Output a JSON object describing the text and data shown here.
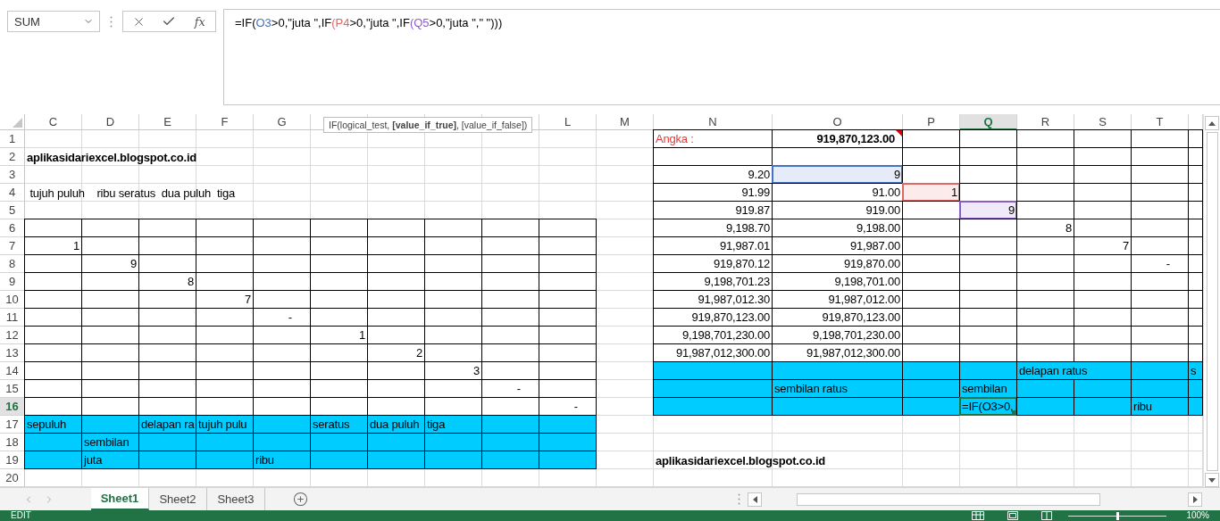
{
  "name_box": {
    "value": "SUM"
  },
  "function_button": "fx",
  "formula_bar": {
    "parts": [
      {
        "text": "=IF("
      },
      {
        "text": "O3",
        "color": "#4472c4"
      },
      {
        "text": ">0,\"juta \",IF"
      },
      {
        "text": "(P4",
        "color": "#e06666"
      },
      {
        "text": ">0,\"juta \",IF"
      },
      {
        "text": "(Q5",
        "color": "#8e5cc7"
      },
      {
        "text": ">0,\"juta \",\" \")))"
      }
    ]
  },
  "tooltip": "IF(logical_test, **[value_if_true]**, [value_if_false])",
  "columns": [
    {
      "label": "C",
      "selected": false
    },
    {
      "label": "D",
      "selected": false
    },
    {
      "label": "E",
      "selected": false
    },
    {
      "label": "F",
      "selected": false
    },
    {
      "label": "G",
      "selected": false
    },
    {
      "selected": false
    },
    {
      "selected": false
    },
    {
      "selected": false
    },
    {
      "selected": false
    },
    {
      "label": "L",
      "selected": false
    },
    {
      "label": "M",
      "selected": false
    },
    {
      "label": "N",
      "selected": false
    },
    {
      "label": "O",
      "selected": false
    },
    {
      "label": "P",
      "selected": false
    },
    {
      "label": "Q",
      "selected": true
    },
    {
      "label": "R",
      "selected": false
    },
    {
      "label": "S",
      "selected": false
    },
    {
      "label": "T",
      "selected": false
    },
    {
      "selected": false
    }
  ],
  "rows": [
    {
      "label": "1",
      "selected": false,
      "cells": [
        {
          "kind": "plain"
        },
        {
          "kind": "plain"
        },
        {
          "kind": "plain"
        },
        {
          "kind": "plain"
        },
        {
          "kind": "plain"
        },
        {
          "kind": "plain"
        },
        {
          "kind": "plain"
        },
        {
          "kind": "plain"
        },
        {
          "kind": "plain"
        },
        {
          "kind": "plain"
        },
        {
          "kind": "plain"
        },
        {
          "kind": "label",
          "text": "Angka :",
          "color": "#e03c3c"
        },
        {
          "kind": "total",
          "text": "919,870,123.00"
        },
        {
          "kind": "box"
        },
        {
          "kind": "box"
        },
        {
          "kind": "box"
        },
        {
          "kind": "box"
        },
        {
          "kind": "box"
        },
        {
          "kind": "box"
        }
      ]
    },
    {
      "label": "2",
      "selected": false,
      "cells": [
        {
          "kind": "heading",
          "text": "aplikasidariexcel.blogspot.co.id"
        },
        {
          "kind": "plain"
        },
        {
          "kind": "plain"
        },
        {
          "kind": "plain"
        },
        {
          "kind": "plain"
        },
        {
          "kind": "plain"
        },
        {
          "kind": "plain"
        },
        {
          "kind": "plain"
        },
        {
          "kind": "plain"
        },
        {
          "kind": "plain"
        },
        {
          "kind": "plain"
        },
        {
          "kind": "box"
        },
        {
          "kind": "box"
        },
        {
          "kind": "box"
        },
        {
          "kind": "box"
        },
        {
          "kind": "box"
        },
        {
          "kind": "box"
        },
        {
          "kind": "box"
        },
        {
          "kind": "box"
        }
      ]
    },
    {
      "label": "3",
      "selected": false,
      "cells": [
        {
          "kind": "plain"
        },
        {
          "kind": "plain"
        },
        {
          "kind": "plain"
        },
        {
          "kind": "plain"
        },
        {
          "kind": "plain"
        },
        {
          "kind": "plain"
        },
        {
          "kind": "plain"
        },
        {
          "kind": "plain"
        },
        {
          "kind": "plain"
        },
        {
          "kind": "plain"
        },
        {
          "kind": "plain"
        },
        {
          "kind": "number",
          "text": "9.20"
        },
        {
          "kind": "reference",
          "text": "9",
          "color": "#4472c4"
        },
        {
          "kind": "box"
        },
        {
          "kind": "box"
        },
        {
          "kind": "box"
        },
        {
          "kind": "box"
        },
        {
          "kind": "box"
        },
        {
          "kind": "box"
        }
      ]
    },
    {
      "label": "4",
      "selected": false,
      "cells": [
        {
          "kind": "plain",
          "text": " tujuh puluh    ribu seratus  dua puluh  tiga"
        },
        {
          "kind": "plain"
        },
        {
          "kind": "plain"
        },
        {
          "kind": "plain"
        },
        {
          "kind": "plain"
        },
        {
          "kind": "plain"
        },
        {
          "kind": "plain"
        },
        {
          "kind": "plain"
        },
        {
          "kind": "plain"
        },
        {
          "kind": "plain"
        },
        {
          "kind": "plain"
        },
        {
          "kind": "number",
          "text": "91.99"
        },
        {
          "kind": "number",
          "text": "91.00"
        },
        {
          "kind": "reference",
          "text": "1",
          "color": "#e06666"
        },
        {
          "kind": "box"
        },
        {
          "kind": "box"
        },
        {
          "kind": "box"
        },
        {
          "kind": "box"
        },
        {
          "kind": "box"
        }
      ]
    },
    {
      "label": "5",
      "selected": false,
      "cells": [
        {
          "kind": "plain"
        },
        {
          "kind": "plain"
        },
        {
          "kind": "plain"
        },
        {
          "kind": "plain"
        },
        {
          "kind": "plain"
        },
        {
          "kind": "plain"
        },
        {
          "kind": "plain"
        },
        {
          "kind": "plain"
        },
        {
          "kind": "plain"
        },
        {
          "kind": "plain"
        },
        {
          "kind": "plain"
        },
        {
          "kind": "number",
          "text": "919.87"
        },
        {
          "kind": "number",
          "text": "919.00"
        },
        {
          "kind": "box"
        },
        {
          "kind": "reference",
          "text": "9",
          "color": "#8e5cc7"
        },
        {
          "kind": "box"
        },
        {
          "kind": "box"
        },
        {
          "kind": "box"
        },
        {
          "kind": "box"
        }
      ]
    },
    {
      "label": "6",
      "selected": false,
      "cells": [
        {
          "kind": "box"
        },
        {
          "kind": "box"
        },
        {
          "kind": "box"
        },
        {
          "kind": "box"
        },
        {
          "kind": "box"
        },
        {
          "kind": "box"
        },
        {
          "kind": "box"
        },
        {
          "kind": "box"
        },
        {
          "kind": "box"
        },
        {
          "kind": "box"
        },
        {
          "kind": "plain"
        },
        {
          "kind": "number",
          "text": "9,198.70"
        },
        {
          "kind": "number",
          "text": "9,198.00"
        },
        {
          "kind": "box"
        },
        {
          "kind": "box"
        },
        {
          "kind": "number",
          "text": "8"
        },
        {
          "kind": "box"
        },
        {
          "kind": "box"
        },
        {
          "kind": "box"
        }
      ]
    },
    {
      "label": "7",
      "selected": false,
      "cells": [
        {
          "kind": "number",
          "text": "1"
        },
        {
          "kind": "box"
        },
        {
          "kind": "box"
        },
        {
          "kind": "box"
        },
        {
          "kind": "box"
        },
        {
          "kind": "box"
        },
        {
          "kind": "box"
        },
        {
          "kind": "box"
        },
        {
          "kind": "box"
        },
        {
          "kind": "box"
        },
        {
          "kind": "plain"
        },
        {
          "kind": "number",
          "text": "91,987.01"
        },
        {
          "kind": "number",
          "text": "91,987.00"
        },
        {
          "kind": "box"
        },
        {
          "kind": "box"
        },
        {
          "kind": "box"
        },
        {
          "kind": "number",
          "text": "7"
        },
        {
          "kind": "box"
        },
        {
          "kind": "box"
        }
      ]
    },
    {
      "label": "8",
      "selected": false,
      "cells": [
        {
          "kind": "box"
        },
        {
          "kind": "number",
          "text": "9"
        },
        {
          "kind": "box"
        },
        {
          "kind": "box"
        },
        {
          "kind": "box"
        },
        {
          "kind": "box"
        },
        {
          "kind": "box"
        },
        {
          "kind": "box"
        },
        {
          "kind": "box"
        },
        {
          "kind": "box"
        },
        {
          "kind": "plain"
        },
        {
          "kind": "number",
          "text": "919,870.12"
        },
        {
          "kind": "number",
          "text": "919,870.00"
        },
        {
          "kind": "box"
        },
        {
          "kind": "box"
        },
        {
          "kind": "box"
        },
        {
          "kind": "box"
        },
        {
          "kind": "dash",
          "text": "-"
        },
        {
          "kind": "box"
        }
      ]
    },
    {
      "label": "9",
      "selected": false,
      "cells": [
        {
          "kind": "box"
        },
        {
          "kind": "box"
        },
        {
          "kind": "number",
          "text": "8"
        },
        {
          "kind": "box"
        },
        {
          "kind": "box"
        },
        {
          "kind": "box"
        },
        {
          "kind": "box"
        },
        {
          "kind": "box"
        },
        {
          "kind": "box"
        },
        {
          "kind": "box"
        },
        {
          "kind": "plain"
        },
        {
          "kind": "number",
          "text": "9,198,701.23"
        },
        {
          "kind": "number",
          "text": "9,198,701.00"
        },
        {
          "kind": "box"
        },
        {
          "kind": "box"
        },
        {
          "kind": "box"
        },
        {
          "kind": "box"
        },
        {
          "kind": "box"
        },
        {
          "kind": "box"
        }
      ]
    },
    {
      "label": "10",
      "selected": false,
      "cells": [
        {
          "kind": "box"
        },
        {
          "kind": "box"
        },
        {
          "kind": "box"
        },
        {
          "kind": "number",
          "text": "7"
        },
        {
          "kind": "box"
        },
        {
          "kind": "box"
        },
        {
          "kind": "box"
        },
        {
          "kind": "box"
        },
        {
          "kind": "box"
        },
        {
          "kind": "box"
        },
        {
          "kind": "plain"
        },
        {
          "kind": "number",
          "text": "91,987,012.30"
        },
        {
          "kind": "number",
          "text": "91,987,012.00"
        },
        {
          "kind": "box"
        },
        {
          "kind": "box"
        },
        {
          "kind": "box"
        },
        {
          "kind": "box"
        },
        {
          "kind": "box"
        },
        {
          "kind": "box"
        }
      ]
    },
    {
      "label": "11",
      "selected": false,
      "cells": [
        {
          "kind": "box"
        },
        {
          "kind": "box"
        },
        {
          "kind": "box"
        },
        {
          "kind": "box"
        },
        {
          "kind": "dash",
          "text": "-"
        },
        {
          "kind": "box"
        },
        {
          "kind": "box"
        },
        {
          "kind": "box"
        },
        {
          "kind": "box"
        },
        {
          "kind": "box"
        },
        {
          "kind": "plain"
        },
        {
          "kind": "number",
          "text": "919,870,123.00"
        },
        {
          "kind": "number",
          "text": "919,870,123.00"
        },
        {
          "kind": "box"
        },
        {
          "kind": "box"
        },
        {
          "kind": "box"
        },
        {
          "kind": "box"
        },
        {
          "kind": "box"
        },
        {
          "kind": "box"
        }
      ]
    },
    {
      "label": "12",
      "selected": false,
      "cells": [
        {
          "kind": "box"
        },
        {
          "kind": "box"
        },
        {
          "kind": "box"
        },
        {
          "kind": "box"
        },
        {
          "kind": "box"
        },
        {
          "kind": "number",
          "text": "1"
        },
        {
          "kind": "box"
        },
        {
          "kind": "box"
        },
        {
          "kind": "box"
        },
        {
          "kind": "box"
        },
        {
          "kind": "plain"
        },
        {
          "kind": "number",
          "text": "9,198,701,230.00"
        },
        {
          "kind": "number",
          "text": "9,198,701,230.00"
        },
        {
          "kind": "box"
        },
        {
          "kind": "box"
        },
        {
          "kind": "box"
        },
        {
          "kind": "box"
        },
        {
          "kind": "box"
        },
        {
          "kind": "box"
        }
      ]
    },
    {
      "label": "13",
      "selected": false,
      "cells": [
        {
          "kind": "box"
        },
        {
          "kind": "box"
        },
        {
          "kind": "box"
        },
        {
          "kind": "box"
        },
        {
          "kind": "box"
        },
        {
          "kind": "box"
        },
        {
          "kind": "number",
          "text": "2"
        },
        {
          "kind": "box"
        },
        {
          "kind": "box"
        },
        {
          "kind": "box"
        },
        {
          "kind": "plain"
        },
        {
          "kind": "number",
          "text": "91,987,012,300.00"
        },
        {
          "kind": "number",
          "text": "91,987,012,300.00"
        },
        {
          "kind": "box"
        },
        {
          "kind": "box"
        },
        {
          "kind": "box"
        },
        {
          "kind": "box"
        },
        {
          "kind": "box"
        },
        {
          "kind": "box"
        }
      ]
    },
    {
      "label": "14",
      "selected": false,
      "cells": [
        {
          "kind": "box"
        },
        {
          "kind": "box"
        },
        {
          "kind": "box"
        },
        {
          "kind": "box"
        },
        {
          "kind": "box"
        },
        {
          "kind": "box"
        },
        {
          "kind": "box"
        },
        {
          "kind": "number",
          "text": "3"
        },
        {
          "kind": "box"
        },
        {
          "kind": "box"
        },
        {
          "kind": "plain"
        },
        {
          "kind": "fill"
        },
        {
          "kind": "fill"
        },
        {
          "kind": "fill"
        },
        {
          "kind": "fill"
        },
        {
          "kind": "wide",
          "text": "delapan ratus"
        },
        {
          "kind": "fill"
        },
        {
          "kind": "fill",
          "text": "s"
        }
      ]
    },
    {
      "label": "15",
      "selected": false,
      "cells": [
        {
          "kind": "box"
        },
        {
          "kind": "box"
        },
        {
          "kind": "box"
        },
        {
          "kind": "box"
        },
        {
          "kind": "box"
        },
        {
          "kind": "box"
        },
        {
          "kind": "box"
        },
        {
          "kind": "box"
        },
        {
          "kind": "dash",
          "text": "-"
        },
        {
          "kind": "box"
        },
        {
          "kind": "plain"
        },
        {
          "kind": "fill"
        },
        {
          "kind": "fill",
          "text": "sembilan ratus"
        },
        {
          "kind": "fill"
        },
        {
          "kind": "fill",
          "text": "sembilan"
        },
        {
          "kind": "fill"
        },
        {
          "kind": "fill"
        },
        {
          "kind": "fill"
        },
        {
          "kind": "fill"
        }
      ]
    },
    {
      "label": "16",
      "selected": true,
      "cells": [
        {
          "kind": "box"
        },
        {
          "kind": "box"
        },
        {
          "kind": "box"
        },
        {
          "kind": "box"
        },
        {
          "kind": "box"
        },
        {
          "kind": "box"
        },
        {
          "kind": "box"
        },
        {
          "kind": "box"
        },
        {
          "kind": "box"
        },
        {
          "kind": "dash",
          "text": "-"
        },
        {
          "kind": "plain"
        },
        {
          "kind": "fill"
        },
        {
          "kind": "fill"
        },
        {
          "kind": "fill"
        },
        {
          "kind": "active",
          "text": "=IF(O3>0,"
        },
        {
          "kind": "fill"
        },
        {
          "kind": "fill"
        },
        {
          "kind": "fill",
          "text": "ribu"
        },
        {
          "kind": "fill"
        }
      ]
    },
    {
      "label": "17",
      "selected": false,
      "cells": [
        {
          "kind": "fill",
          "text": "sepuluh"
        },
        {
          "kind": "fill"
        },
        {
          "kind": "fill",
          "text": "delapan ra"
        },
        {
          "kind": "fill",
          "text": "tujuh pulu"
        },
        {
          "kind": "fill"
        },
        {
          "kind": "fill",
          "text": "seratus"
        },
        {
          "kind": "fill",
          "text": "dua puluh"
        },
        {
          "kind": "fill",
          "text": "tiga"
        },
        {
          "kind": "fill"
        },
        {
          "kind": "fill"
        },
        {
          "kind": "plain"
        },
        {
          "kind": "plain"
        },
        {
          "kind": "plain"
        },
        {
          "kind": "plain"
        },
        {
          "kind": "plain"
        },
        {
          "kind": "plain"
        },
        {
          "kind": "plain"
        },
        {
          "kind": "plain"
        },
        {
          "kind": "plain"
        }
      ]
    },
    {
      "label": "18",
      "selected": false,
      "cells": [
        {
          "kind": "fill"
        },
        {
          "kind": "fill",
          "text": "sembilan"
        },
        {
          "kind": "fill"
        },
        {
          "kind": "fill"
        },
        {
          "kind": "fill"
        },
        {
          "kind": "fill"
        },
        {
          "kind": "fill"
        },
        {
          "kind": "fill"
        },
        {
          "kind": "fill"
        },
        {
          "kind": "fill"
        },
        {
          "kind": "plain"
        },
        {
          "kind": "plain"
        },
        {
          "kind": "plain"
        },
        {
          "kind": "plain"
        },
        {
          "kind": "plain"
        },
        {
          "kind": "plain"
        },
        {
          "kind": "plain"
        },
        {
          "kind": "plain"
        },
        {
          "kind": "plain"
        }
      ]
    },
    {
      "label": "19",
      "selected": false,
      "cells": [
        {
          "kind": "fill"
        },
        {
          "kind": "fill",
          "text": "juta"
        },
        {
          "kind": "fill"
        },
        {
          "kind": "fill"
        },
        {
          "kind": "fill",
          "text": "ribu"
        },
        {
          "kind": "fill"
        },
        {
          "kind": "fill"
        },
        {
          "kind": "fill"
        },
        {
          "kind": "fill"
        },
        {
          "kind": "fill"
        },
        {
          "kind": "plain"
        },
        {
          "kind": "heading",
          "text": "aplikasidariexcel.blogspot.co.id"
        },
        {
          "kind": "plain"
        },
        {
          "kind": "plain"
        },
        {
          "kind": "plain"
        },
        {
          "kind": "plain"
        },
        {
          "kind": "plain"
        },
        {
          "kind": "plain"
        },
        {
          "kind": "plain"
        }
      ]
    },
    {
      "label": "20",
      "selected": false,
      "cells": [
        {
          "kind": "plain"
        },
        {
          "kind": "plain"
        },
        {
          "kind": "plain"
        },
        {
          "kind": "plain"
        },
        {
          "kind": "plain"
        },
        {
          "kind": "plain"
        },
        {
          "kind": "plain"
        },
        {
          "kind": "plain"
        },
        {
          "kind": "plain"
        },
        {
          "kind": "plain"
        },
        {
          "kind": "plain"
        },
        {
          "kind": "plain"
        },
        {
          "kind": "plain"
        },
        {
          "kind": "plain"
        },
        {
          "kind": "plain"
        },
        {
          "kind": "plain"
        },
        {
          "kind": "plain"
        },
        {
          "kind": "plain"
        },
        {
          "kind": "plain"
        }
      ]
    }
  ],
  "sheet_tabs": [
    {
      "label": "Sheet1",
      "selected": true
    },
    {
      "label": "Sheet2",
      "selected": false
    },
    {
      "label": "Sheet3",
      "selected": false
    }
  ],
  "status_bar": {
    "mode": "EDIT",
    "zoom_slider": {
      "level": 0.5
    },
    "zoom": "100%"
  }
}
